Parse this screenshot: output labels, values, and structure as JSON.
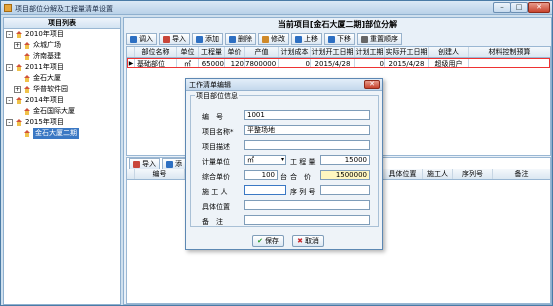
{
  "window": {
    "title": "项目部位分解及工程量清单设置",
    "min": "–",
    "max": "□",
    "close": "✕"
  },
  "tree": {
    "header": "项目列表",
    "nodes": [
      {
        "label": "2010年项目",
        "exp": "-"
      },
      {
        "label": "众城广场",
        "exp": "+"
      },
      {
        "label": "济南基建",
        "exp": ""
      },
      {
        "label": "2011年项目",
        "exp": "-"
      },
      {
        "label": "金石大厦",
        "exp": ""
      },
      {
        "label": "华普软件园",
        "exp": "+"
      },
      {
        "label": "2014年项目",
        "exp": "-"
      },
      {
        "label": "金石国际大厦",
        "exp": ""
      },
      {
        "label": "2015年项目",
        "exp": "-"
      },
      {
        "label": "金石大厦二期",
        "exp": ""
      }
    ]
  },
  "main": {
    "title": "当前项目[金石大厦二期]部位分解",
    "toolbar": [
      "调入",
      "导入",
      "添加",
      "删除",
      "修改",
      "上移",
      "下移",
      "重置顺序"
    ],
    "columns": [
      "部位名称",
      "单位",
      "工程量",
      "单价",
      "产值",
      "计划成本",
      "计划开工日期",
      "计划工期",
      "实际开工日期",
      "创建人",
      "材料控制预算"
    ],
    "row": [
      "基础部位",
      "㎡",
      "65000",
      "120",
      "7800000",
      "0",
      "2015/4/28",
      "0",
      "2015/4/28",
      "超级用户",
      ""
    ],
    "row_marker": "▶"
  },
  "lower": {
    "toolbar": [
      "导入",
      "添"
    ],
    "columns": [
      "编号",
      "",
      "",
      "",
      "",
      "",
      "具体位置",
      "施工人",
      "序列号",
      "备注"
    ]
  },
  "dialog": {
    "title": "工作清单编辑",
    "group": "项目部位信息",
    "labels": {
      "code": "编　号",
      "name": "项目名称*",
      "desc": "项目描述",
      "unit": "计量单位",
      "qty": "工 程 量",
      "price": "综合单价",
      "total": "合　价",
      "worker": "施 工 人",
      "serial": "序 列 号",
      "loc": "具体位置",
      "note": "备　注"
    },
    "values": {
      "code": "1001",
      "name": "平整场地",
      "desc": "",
      "unit": "㎡",
      "qty": "15000",
      "price": "100",
      "price_unit": "台",
      "total": "1500000",
      "worker": "",
      "serial": "",
      "loc": "",
      "note": ""
    },
    "save": "保存",
    "cancel": "取消"
  }
}
